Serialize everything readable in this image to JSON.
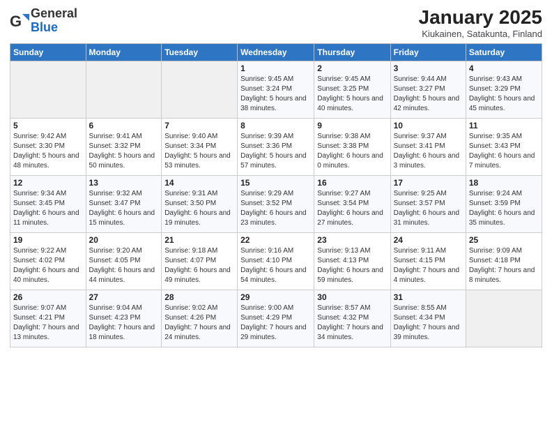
{
  "header": {
    "logo_general": "General",
    "logo_blue": "Blue",
    "month": "January 2025",
    "location": "Kiukainen, Satakunta, Finland"
  },
  "weekdays": [
    "Sunday",
    "Monday",
    "Tuesday",
    "Wednesday",
    "Thursday",
    "Friday",
    "Saturday"
  ],
  "weeks": [
    [
      {
        "day": "",
        "info": ""
      },
      {
        "day": "",
        "info": ""
      },
      {
        "day": "",
        "info": ""
      },
      {
        "day": "1",
        "info": "Sunrise: 9:45 AM\nSunset: 3:24 PM\nDaylight: 5 hours and 38 minutes."
      },
      {
        "day": "2",
        "info": "Sunrise: 9:45 AM\nSunset: 3:25 PM\nDaylight: 5 hours and 40 minutes."
      },
      {
        "day": "3",
        "info": "Sunrise: 9:44 AM\nSunset: 3:27 PM\nDaylight: 5 hours and 42 minutes."
      },
      {
        "day": "4",
        "info": "Sunrise: 9:43 AM\nSunset: 3:29 PM\nDaylight: 5 hours and 45 minutes."
      }
    ],
    [
      {
        "day": "5",
        "info": "Sunrise: 9:42 AM\nSunset: 3:30 PM\nDaylight: 5 hours and 48 minutes."
      },
      {
        "day": "6",
        "info": "Sunrise: 9:41 AM\nSunset: 3:32 PM\nDaylight: 5 hours and 50 minutes."
      },
      {
        "day": "7",
        "info": "Sunrise: 9:40 AM\nSunset: 3:34 PM\nDaylight: 5 hours and 53 minutes."
      },
      {
        "day": "8",
        "info": "Sunrise: 9:39 AM\nSunset: 3:36 PM\nDaylight: 5 hours and 57 minutes."
      },
      {
        "day": "9",
        "info": "Sunrise: 9:38 AM\nSunset: 3:38 PM\nDaylight: 6 hours and 0 minutes."
      },
      {
        "day": "10",
        "info": "Sunrise: 9:37 AM\nSunset: 3:41 PM\nDaylight: 6 hours and 3 minutes."
      },
      {
        "day": "11",
        "info": "Sunrise: 9:35 AM\nSunset: 3:43 PM\nDaylight: 6 hours and 7 minutes."
      }
    ],
    [
      {
        "day": "12",
        "info": "Sunrise: 9:34 AM\nSunset: 3:45 PM\nDaylight: 6 hours and 11 minutes."
      },
      {
        "day": "13",
        "info": "Sunrise: 9:32 AM\nSunset: 3:47 PM\nDaylight: 6 hours and 15 minutes."
      },
      {
        "day": "14",
        "info": "Sunrise: 9:31 AM\nSunset: 3:50 PM\nDaylight: 6 hours and 19 minutes."
      },
      {
        "day": "15",
        "info": "Sunrise: 9:29 AM\nSunset: 3:52 PM\nDaylight: 6 hours and 23 minutes."
      },
      {
        "day": "16",
        "info": "Sunrise: 9:27 AM\nSunset: 3:54 PM\nDaylight: 6 hours and 27 minutes."
      },
      {
        "day": "17",
        "info": "Sunrise: 9:25 AM\nSunset: 3:57 PM\nDaylight: 6 hours and 31 minutes."
      },
      {
        "day": "18",
        "info": "Sunrise: 9:24 AM\nSunset: 3:59 PM\nDaylight: 6 hours and 35 minutes."
      }
    ],
    [
      {
        "day": "19",
        "info": "Sunrise: 9:22 AM\nSunset: 4:02 PM\nDaylight: 6 hours and 40 minutes."
      },
      {
        "day": "20",
        "info": "Sunrise: 9:20 AM\nSunset: 4:05 PM\nDaylight: 6 hours and 44 minutes."
      },
      {
        "day": "21",
        "info": "Sunrise: 9:18 AM\nSunset: 4:07 PM\nDaylight: 6 hours and 49 minutes."
      },
      {
        "day": "22",
        "info": "Sunrise: 9:16 AM\nSunset: 4:10 PM\nDaylight: 6 hours and 54 minutes."
      },
      {
        "day": "23",
        "info": "Sunrise: 9:13 AM\nSunset: 4:13 PM\nDaylight: 6 hours and 59 minutes."
      },
      {
        "day": "24",
        "info": "Sunrise: 9:11 AM\nSunset: 4:15 PM\nDaylight: 7 hours and 4 minutes."
      },
      {
        "day": "25",
        "info": "Sunrise: 9:09 AM\nSunset: 4:18 PM\nDaylight: 7 hours and 8 minutes."
      }
    ],
    [
      {
        "day": "26",
        "info": "Sunrise: 9:07 AM\nSunset: 4:21 PM\nDaylight: 7 hours and 13 minutes."
      },
      {
        "day": "27",
        "info": "Sunrise: 9:04 AM\nSunset: 4:23 PM\nDaylight: 7 hours and 18 minutes."
      },
      {
        "day": "28",
        "info": "Sunrise: 9:02 AM\nSunset: 4:26 PM\nDaylight: 7 hours and 24 minutes."
      },
      {
        "day": "29",
        "info": "Sunrise: 9:00 AM\nSunset: 4:29 PM\nDaylight: 7 hours and 29 minutes."
      },
      {
        "day": "30",
        "info": "Sunrise: 8:57 AM\nSunset: 4:32 PM\nDaylight: 7 hours and 34 minutes."
      },
      {
        "day": "31",
        "info": "Sunrise: 8:55 AM\nSunset: 4:34 PM\nDaylight: 7 hours and 39 minutes."
      },
      {
        "day": "",
        "info": ""
      }
    ]
  ]
}
